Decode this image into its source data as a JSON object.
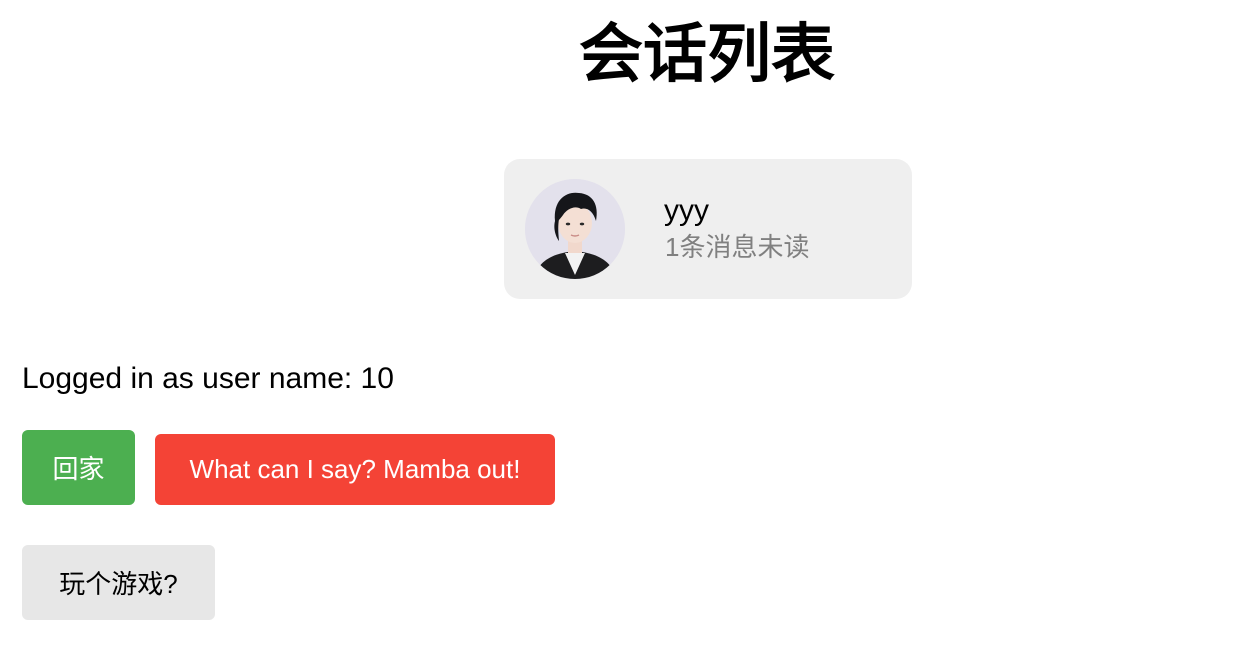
{
  "header": {
    "title": "会话列表"
  },
  "conversations": [
    {
      "name": "yyy",
      "unread_text": "1条消息未读",
      "avatar_icon": "user-avatar-photo"
    }
  ],
  "session": {
    "status_text": "Logged in as user name: 10"
  },
  "actions": {
    "home_label": "回家",
    "mamba_label": "What can I say? Mamba out!",
    "game_label": "玩个游戏?"
  },
  "colors": {
    "home_button": "#4caf50",
    "mamba_button": "#f44336",
    "game_button": "#e7e7e7",
    "card_background": "#efefef",
    "unread_text": "#808080"
  }
}
